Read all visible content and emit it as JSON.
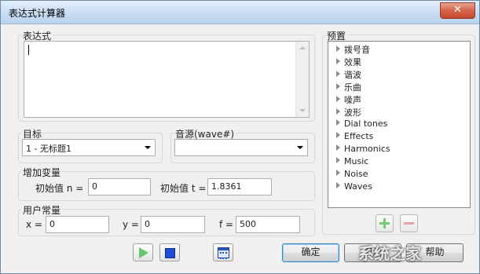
{
  "window": {
    "title": "表达式计算器",
    "close_glyph": "✕"
  },
  "expression": {
    "label": "表达式",
    "value": ""
  },
  "target": {
    "label": "目标",
    "selected": "1 - 无标题1"
  },
  "source": {
    "label": "音源(wave#)",
    "selected": ""
  },
  "increment": {
    "label": "增加变量",
    "n_label": "初始值 n =",
    "n_value": "0",
    "t_label": "初始值 t =",
    "t_value": "1.8361"
  },
  "constants": {
    "label": "用户常量",
    "x_label": "x =",
    "x_value": "0",
    "y_label": "y =",
    "y_value": "0",
    "f_label": "f =",
    "f_value": "500"
  },
  "presets": {
    "label": "预置",
    "items": [
      "拨号音",
      "效果",
      "谐波",
      "乐曲",
      "噪声",
      "波形",
      "Dial tones",
      "Effects",
      "Harmonics",
      "Music",
      "Noise",
      "Waves"
    ]
  },
  "buttons": {
    "ok": "确定",
    "cancel": "取消",
    "help": "帮助"
  },
  "watermark": "系统之家",
  "colors": {
    "play": "#67c66a",
    "stop": "#1a4fd6",
    "add": "#78c878",
    "remove": "#e8a0a0"
  }
}
